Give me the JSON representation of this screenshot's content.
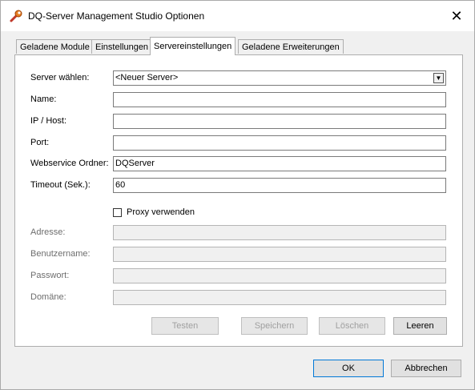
{
  "window": {
    "title": "DQ-Server Management Studio Optionen",
    "close_glyph": "✕"
  },
  "tabs": [
    {
      "label": "Geladene Module"
    },
    {
      "label": "Einstellungen"
    },
    {
      "label": "Servereinstellungen"
    },
    {
      "label": "Geladene Erweiterungen"
    }
  ],
  "active_tab": "Servereinstellungen",
  "form": {
    "server_label": "Server wählen:",
    "server_value": "<Neuer Server>",
    "name_label": "Name:",
    "name_value": "",
    "host_label": "IP / Host:",
    "host_value": "",
    "port_label": "Port:",
    "port_value": "",
    "folder_label": "Webservice Ordner:",
    "folder_value": "DQServer",
    "timeout_label": "Timeout (Sek.):",
    "timeout_value": "60",
    "proxy_label": "Proxy verwenden",
    "proxy_checked": false,
    "address_label": "Adresse:",
    "username_label": "Benutzername:",
    "password_label": "Passwort:",
    "domain_label": "Domäne:"
  },
  "panel_buttons": {
    "test": "Testen",
    "save": "Speichern",
    "delete": "Löschen",
    "clear": "Leeren"
  },
  "dialog_buttons": {
    "ok": "OK",
    "cancel": "Abbrechen"
  },
  "icons": {
    "title": "wrench-icon",
    "dropdown": "chevron-down-icon",
    "close": "close-icon"
  }
}
